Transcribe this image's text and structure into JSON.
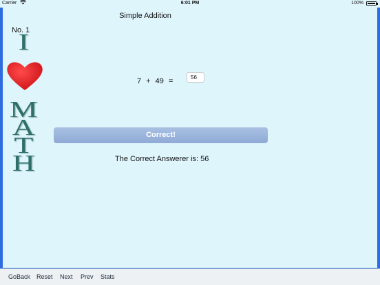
{
  "status_bar": {
    "carrier": "Carrier",
    "time": "6:01 PM",
    "battery_percent": "100%"
  },
  "header": {
    "title": "Simple Addition",
    "counter": "No. 1"
  },
  "logo": {
    "top_letter": "I",
    "heart_icon": "heart-icon",
    "word_letters": [
      "M",
      "A",
      "T",
      "H"
    ],
    "letter_color": "#2f6f6a",
    "heart_color": "#e61f26"
  },
  "problem": {
    "expression": "7 + 49 =",
    "answer_value": "56"
  },
  "result": {
    "label": "Correct!",
    "message": "The Correct Answerer is: 56"
  },
  "toolbar": {
    "goback_label": "GoBack",
    "reset_label": "Reset",
    "next_label": "Next",
    "prev_label": "Prev",
    "stats_label": "Stats"
  },
  "colors": {
    "background": "#dff5fc",
    "frame": "#2f6be0",
    "result_bar": "#97b1da"
  }
}
